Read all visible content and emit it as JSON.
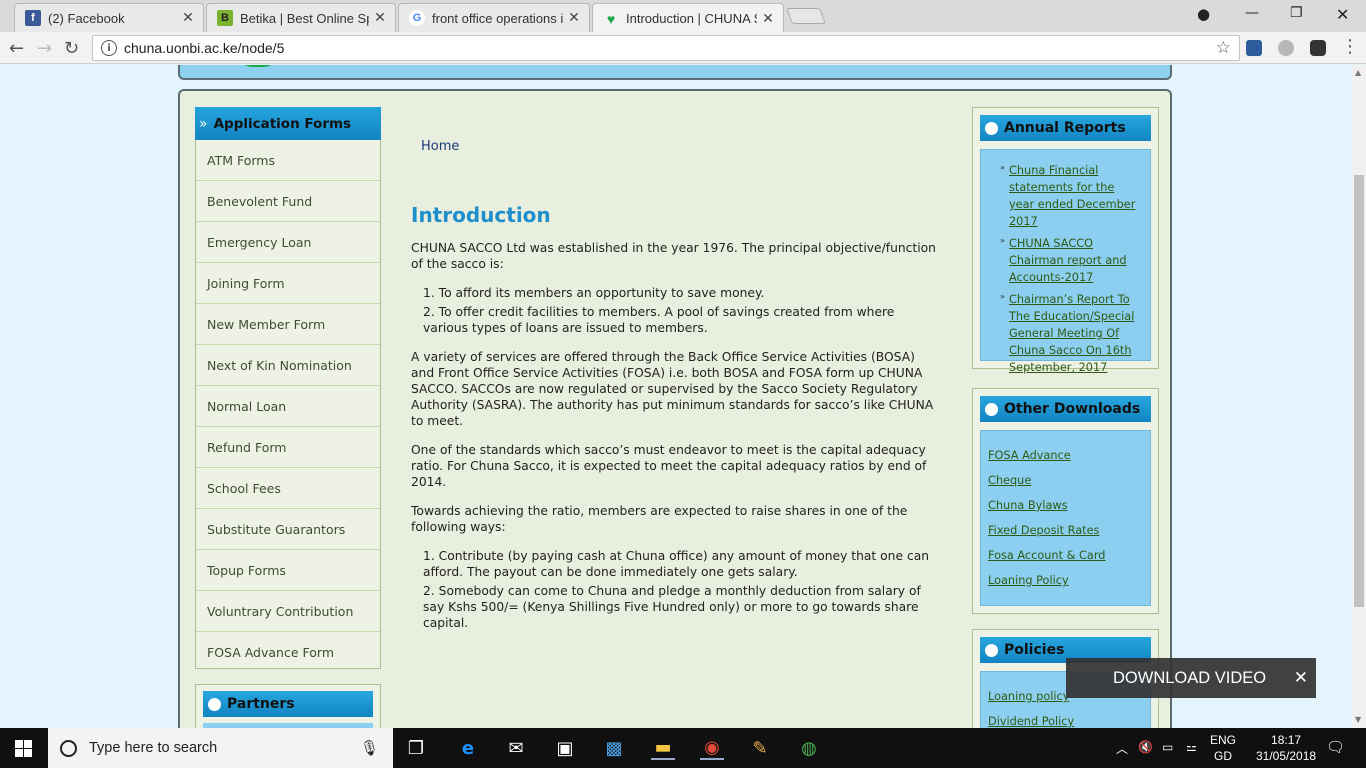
{
  "browser": {
    "tabs": [
      {
        "title": "(2) Facebook",
        "fav_color": "#3b5998",
        "fav_glyph": "f"
      },
      {
        "title": "Betika | Best Online Sport",
        "fav_color": "#7ab32e",
        "fav_glyph": "B"
      },
      {
        "title": "front office operations in",
        "fav_color": "#ffffff",
        "fav_glyph": "G"
      },
      {
        "title": "Introduction | CHUNA SA",
        "fav_color": "#ffffff",
        "fav_glyph": "♥"
      }
    ],
    "url": "chuna.uonbi.ac.ke/node/5"
  },
  "sidebar": {
    "heading": "Application Forms",
    "items": [
      "ATM Forms",
      "Benevolent Fund",
      "Emergency Loan",
      "Joining Form",
      "New Member Form",
      "Next of Kin Nomination",
      "Normal Loan",
      "Refund Form",
      "School Fees",
      "Substitute Guarantors",
      "Topup Forms",
      "Voluntrary Contribution",
      "FOSA Advance Form"
    ],
    "partners_heading": "Partners"
  },
  "main": {
    "breadcrumb": "Home",
    "title": "Introduction",
    "p1": "CHUNA SACCO Ltd was established in the year 1976. The principal objective/function of the sacco is:",
    "list1": [
      "1. To afford its members an opportunity to save money.",
      "2. To offer credit facilities to members.  A pool of savings created from where various types of loans are issued to members."
    ],
    "p2": "A variety of services are offered through the Back Office Service Activities (BOSA) and Front Office Service Activities (FOSA) i.e. both BOSA and FOSA form up CHUNA SACCO.  SACCOs are now regulated or supervised by the Sacco Society Regulatory Authority (SASRA).  The authority has put minimum standards for sacco’s like CHUNA to meet.",
    "p3": "One of the standards which sacco’s must endeavor to meet is the capital adequacy ratio.  For Chuna Sacco, it is expected to meet the capital adequacy ratios by end of 2014.",
    "p4": "Towards achieving the ratio, members are expected to raise shares in one of the following ways:",
    "list2": [
      "1. Contribute (by paying cash at Chuna office) any amount of money that one can afford.  The payout can be done immediately one gets salary.",
      "2. Somebody can come to Chuna and pledge a monthly deduction from salary of say Kshs 500/= (Kenya Shillings Five Hundred only) or more to go towards share capital."
    ]
  },
  "right": {
    "annual_heading": "Annual Reports",
    "annual_items": [
      "Chuna Financial statements for the year ended December 2017",
      "CHUNA SACCO Chairman report and Accounts-2017",
      "Chairman’s Report To The Education/Special General Meeting Of Chuna Sacco On 16th September, 2017"
    ],
    "other_heading": "Other Downloads",
    "other_items": [
      "FOSA Advance",
      "Cheque",
      "Chuna Bylaws",
      "Fixed Deposit Rates",
      "Fosa Account & Card",
      "Loaning Policy"
    ],
    "policies_heading": "Policies",
    "policies_items": [
      "Loaning policy",
      "Dividend Policy"
    ]
  },
  "overlay": {
    "download_label": "DOWNLOAD VIDEO"
  },
  "taskbar": {
    "search_placeholder": "Type here to search",
    "lang_line1": "ENG",
    "lang_line2": "GD",
    "time": "18:17",
    "date": "31/05/2018"
  },
  "colors": {
    "accent": "#1e8fcc",
    "header_blue": "#1384c2",
    "link_green": "#2f5b14"
  }
}
